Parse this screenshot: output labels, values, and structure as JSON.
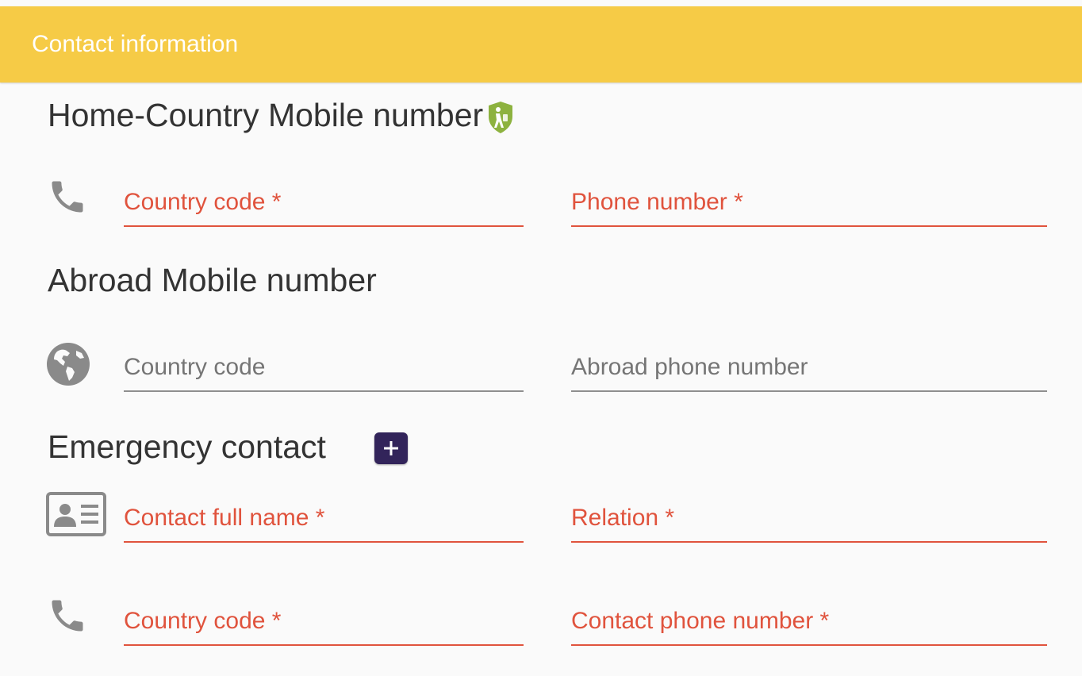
{
  "card": {
    "title": "Contact information"
  },
  "home_mobile": {
    "title": "Home-Country Mobile number",
    "badge_icon": "shield-traveler-icon",
    "row_icon": "phone-icon",
    "country_code_placeholder": "Country code *",
    "phone_placeholder": "Phone number *"
  },
  "abroad_mobile": {
    "title": "Abroad Mobile number",
    "row_icon": "globe-icon",
    "country_code_placeholder": "Country code",
    "phone_placeholder": "Abroad phone number"
  },
  "emergency": {
    "title": "Emergency contact",
    "add_icon": "plus-icon",
    "name_row_icon": "contact-card-icon",
    "full_name_placeholder": "Contact full name *",
    "relation_placeholder": "Relation *",
    "phone_row_icon": "phone-icon",
    "country_code_placeholder": "Country code *",
    "phone_placeholder": "Contact phone number *"
  },
  "colors": {
    "header": "#f6cb46",
    "required": "#e0533d",
    "add_button": "#32245a",
    "badge": "#8db23f"
  }
}
